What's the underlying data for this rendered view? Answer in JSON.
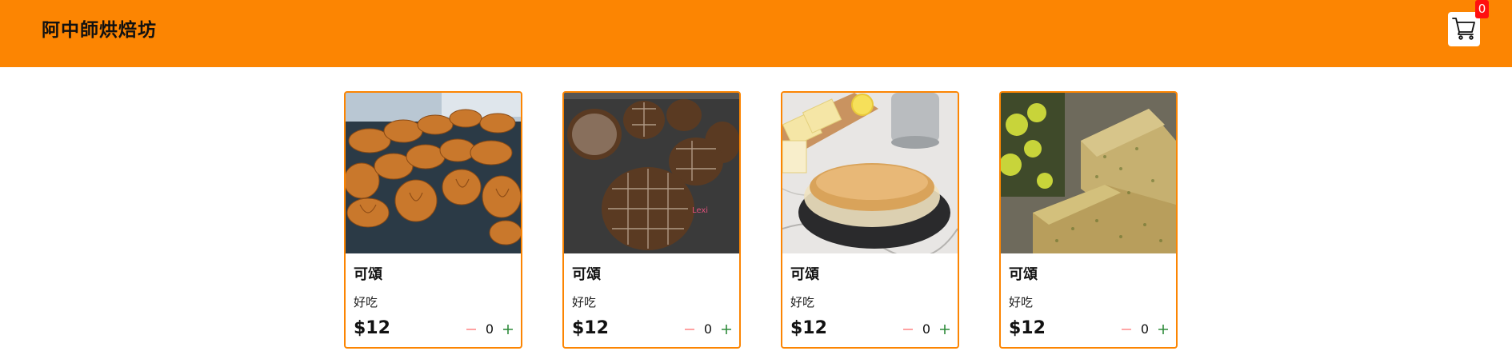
{
  "app": {
    "brand": "阿中師烘焙坊",
    "cart_count": "0",
    "colors": {
      "brand": "#fc8502",
      "badge": "#ff1010",
      "minus": "#ff8a8a",
      "plus": "#2e8b3a"
    }
  },
  "products": [
    {
      "name": "可頌",
      "desc": "好吃",
      "price": "$12",
      "qty": "0",
      "image": "croissants-photo"
    },
    {
      "name": "可頌",
      "desc": "好吃",
      "price": "$12",
      "qty": "0",
      "image": "melon-bread-photo"
    },
    {
      "name": "可頌",
      "desc": "好吃",
      "price": "$12",
      "qty": "0",
      "image": "cheesecake-photo"
    },
    {
      "name": "可頌",
      "desc": "好吃",
      "price": "$12",
      "qty": "0",
      "image": "herb-cake-photo"
    }
  ],
  "icons": {
    "cart": "cart-icon",
    "minus": "minus-icon",
    "plus": "plus-icon"
  }
}
